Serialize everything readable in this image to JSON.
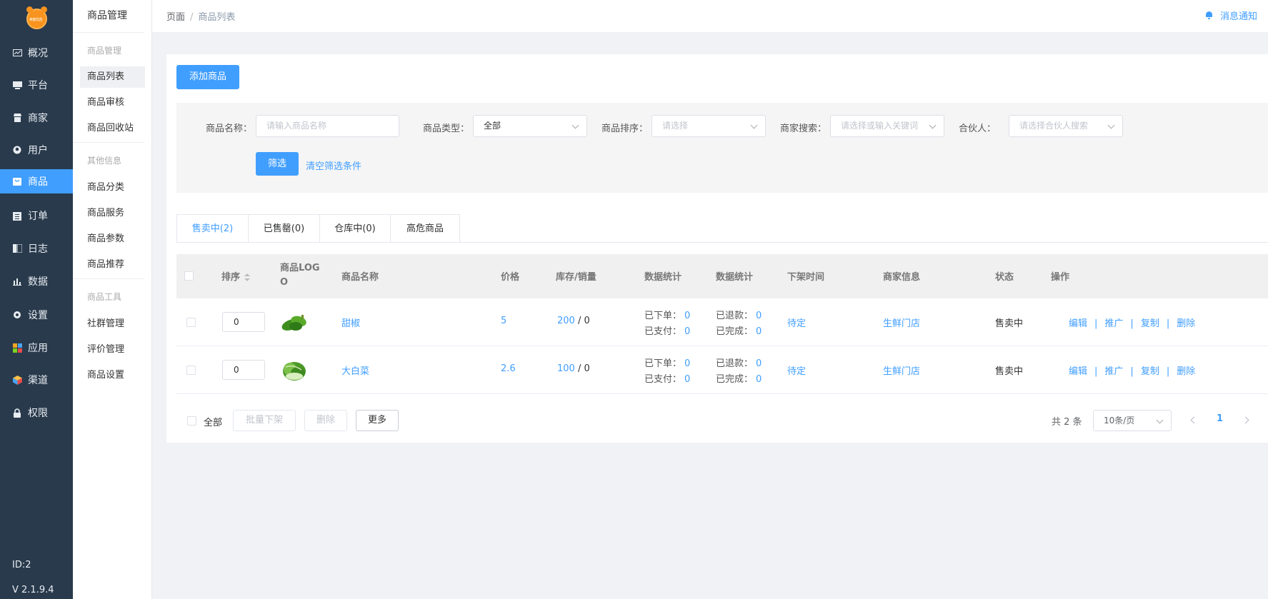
{
  "logo": {
    "text": "卖客优选"
  },
  "nav": {
    "items": [
      {
        "label": "概况",
        "icon": "chart-icon"
      },
      {
        "label": "平台",
        "icon": "monitor-icon"
      },
      {
        "label": "商家",
        "icon": "store-icon"
      },
      {
        "label": "用户",
        "icon": "user-icon"
      },
      {
        "label": "商品",
        "icon": "bag-icon"
      },
      {
        "label": "订单",
        "icon": "clipboard-icon"
      },
      {
        "label": "日志",
        "icon": "book-icon"
      },
      {
        "label": "数据",
        "icon": "bar-chart-icon"
      },
      {
        "label": "设置",
        "icon": "gear-icon"
      },
      {
        "label": "应用",
        "icon": "apps-icon"
      },
      {
        "label": "渠道",
        "icon": "cube-icon"
      },
      {
        "label": "权限",
        "icon": "lock-icon"
      }
    ],
    "active": "商品",
    "id_text": "ID:2",
    "version": "V 2.1.9.4"
  },
  "submenu": {
    "title": "商品管理",
    "groups": [
      {
        "label": "商品管理",
        "items": [
          "商品列表",
          "商品审核",
          "商品回收站"
        ]
      },
      {
        "label": "其他信息",
        "items": [
          "商品分类",
          "商品服务",
          "商品参数",
          "商品推荐"
        ]
      },
      {
        "label": "商品工具",
        "items": [
          "社群管理",
          "评价管理",
          "商品设置"
        ]
      }
    ],
    "active": "商品列表"
  },
  "header": {
    "breadcrumb": [
      "页面",
      "商品列表"
    ],
    "notify_label": "消息通知"
  },
  "toolbar": {
    "add_label": "添加商品"
  },
  "filters": {
    "name_label": "商品名称：",
    "name_placeholder": "请输入商品名称",
    "type_label": "商品类型：",
    "type_value": "全部",
    "sort_label": "商品排序：",
    "sort_placeholder": "请选择",
    "merchant_label": "商家搜索：",
    "merchant_placeholder": "请选择或输入关键词",
    "partner_label": "合伙人：",
    "partner_placeholder": "请选择合伙人搜索",
    "submit_label": "筛选",
    "clear_label": "清空筛选条件"
  },
  "tabs": [
    "售卖中(2)",
    "已售罄(0)",
    "仓库中(0)",
    "高危商品"
  ],
  "table": {
    "headers": {
      "sort": "排序",
      "logo": "商品LOGO",
      "name": "商品名称",
      "price": "价格",
      "stock": "库存/销量",
      "stats1": "数据统计",
      "stats2": "数据统计",
      "offtime": "下架时间",
      "merchant": "商家信息",
      "status": "状态",
      "actions": "操作"
    },
    "rows": [
      {
        "sort": "0",
        "image": "green-pepper",
        "name": "甜椒",
        "price": "5",
        "stock": "200",
        "sales": "0",
        "ordered_label": "已下单：",
        "ordered": "0",
        "paid_label": "已支付：",
        "paid": "0",
        "refund_label": "已退款：",
        "refund": "0",
        "done_label": "已完成：",
        "done": "0",
        "offtime": "待定",
        "merchant": "生鲜门店",
        "status": "售卖中",
        "actions": [
          "编辑",
          "推广",
          "复制",
          "删除"
        ]
      },
      {
        "sort": "0",
        "image": "chinese-cabbage",
        "name": "大白菜",
        "price": "2.6",
        "stock": "100",
        "sales": "0",
        "ordered_label": "已下单：",
        "ordered": "0",
        "paid_label": "已支付：",
        "paid": "0",
        "refund_label": "已退款：",
        "refund": "0",
        "done_label": "已完成：",
        "done": "0",
        "offtime": "待定",
        "merchant": "生鲜门店",
        "status": "售卖中",
        "actions": [
          "编辑",
          "推广",
          "复制",
          "删除"
        ]
      }
    ]
  },
  "footer": {
    "select_all": "全部",
    "batch_off": "批量下架",
    "delete": "删除",
    "more": "更多",
    "total": "共 2 条",
    "page_size": "10条/页",
    "page": "1"
  },
  "colors": {
    "primary": "#409eff",
    "sidebar": "#293a4c"
  }
}
